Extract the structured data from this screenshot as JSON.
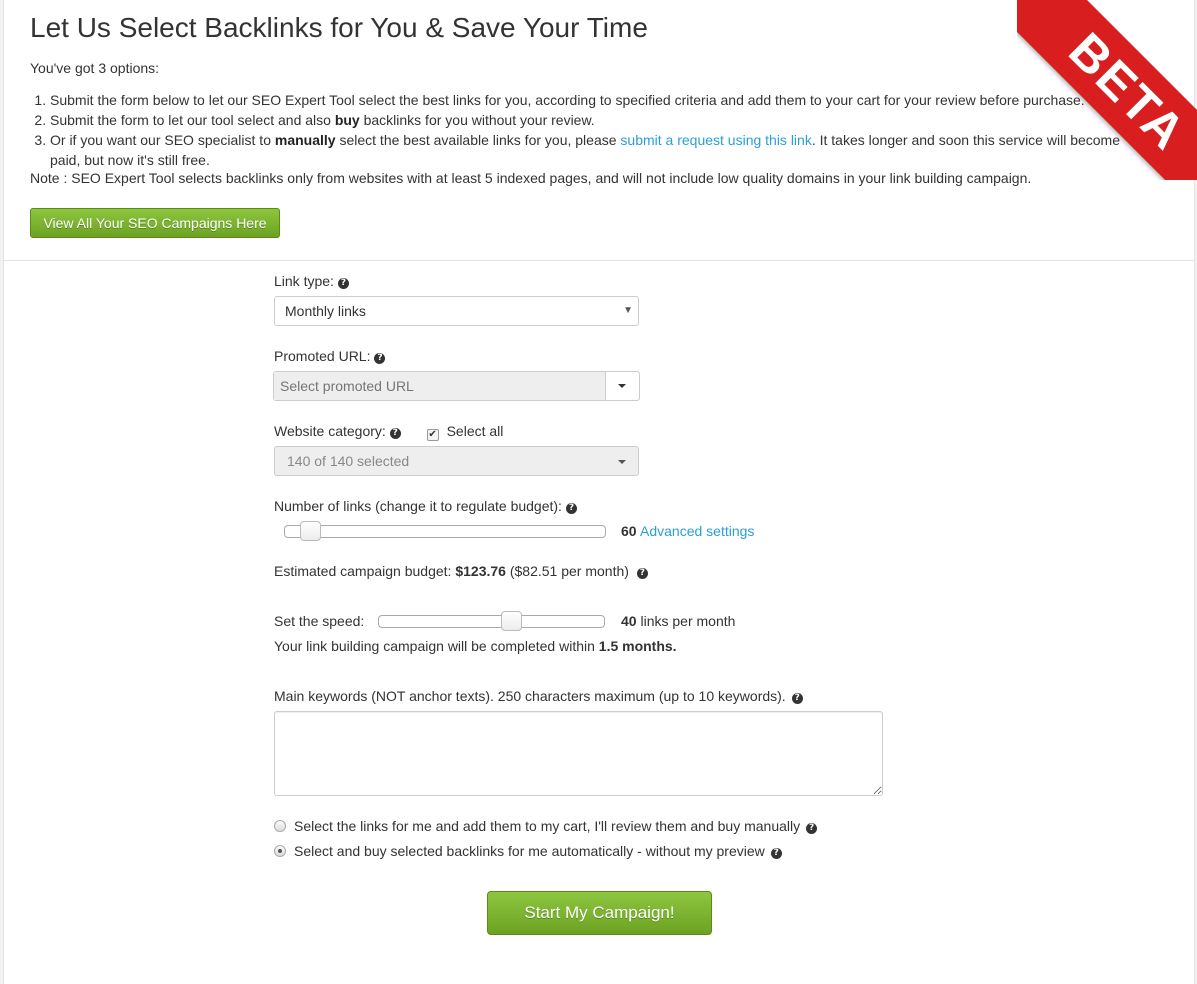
{
  "page": {
    "title": "Let Us Select Backlinks for You & Save Your Time",
    "intro": "You've got 3 options:",
    "options": [
      {
        "pre": "Submit the form below to let our SEO Expert Tool select the best links for you, according to specified criteria and add them to your cart for your review before purchase."
      },
      {
        "pre": "Submit the form to let our tool select and also ",
        "bold": "buy",
        "post": " backlinks for you without your review."
      },
      {
        "pre": "Or if you want our SEO specialist to ",
        "bold": "manually",
        "mid": " select the best available links for you, please ",
        "link": "submit a request using this link",
        "post": ". It takes longer and soon this service will become paid, but now it's still free."
      }
    ],
    "note": "Note : SEO Expert Tool selects backlinks only from websites with at least 5 indexed pages, and will not include low quality domains in your link building campaign.",
    "campaigns_button": "View All Your SEO Campaigns Here",
    "ribbon": "BETA"
  },
  "form": {
    "link_type": {
      "label": "Link type:",
      "value": "Monthly links"
    },
    "promoted_url": {
      "label": "Promoted URL:",
      "placeholder": "Select promoted URL"
    },
    "website_category": {
      "label": "Website category:",
      "select_all": "Select all",
      "select_all_checked": true,
      "value": "140 of 140 selected"
    },
    "num_links": {
      "label": "Number of links (change it to regulate budget):",
      "value": "60",
      "slider_fraction": 0.05,
      "advanced": "Advanced settings"
    },
    "budget": {
      "label": "Estimated campaign budget:",
      "total": "$123.76",
      "monthly": "($82.51 per month)"
    },
    "speed": {
      "label": "Set the speed:",
      "value": "40",
      "unit": "links per month",
      "slider_fraction": 0.6
    },
    "completion": {
      "pre": "Your link building campaign will be completed within ",
      "value": "1.5 months."
    },
    "keywords": {
      "label": "Main keywords (NOT anchor texts). 250 characters maximum (up to 10 keywords).",
      "value": ""
    },
    "mode_manual": {
      "label": "Select the links for me and add them to my cart, I'll review them and buy manually",
      "checked": false
    },
    "mode_auto": {
      "label": "Select and buy selected backlinks for me automatically - without my preview",
      "checked": true
    },
    "submit": "Start My Campaign!"
  },
  "colors": {
    "accent_green": "#7ab32e",
    "ribbon_red": "#d81e1e",
    "link_blue": "#2a9fd6"
  },
  "icons": {
    "help": "question-circle-icon",
    "dropdown": "caret-down-icon"
  }
}
